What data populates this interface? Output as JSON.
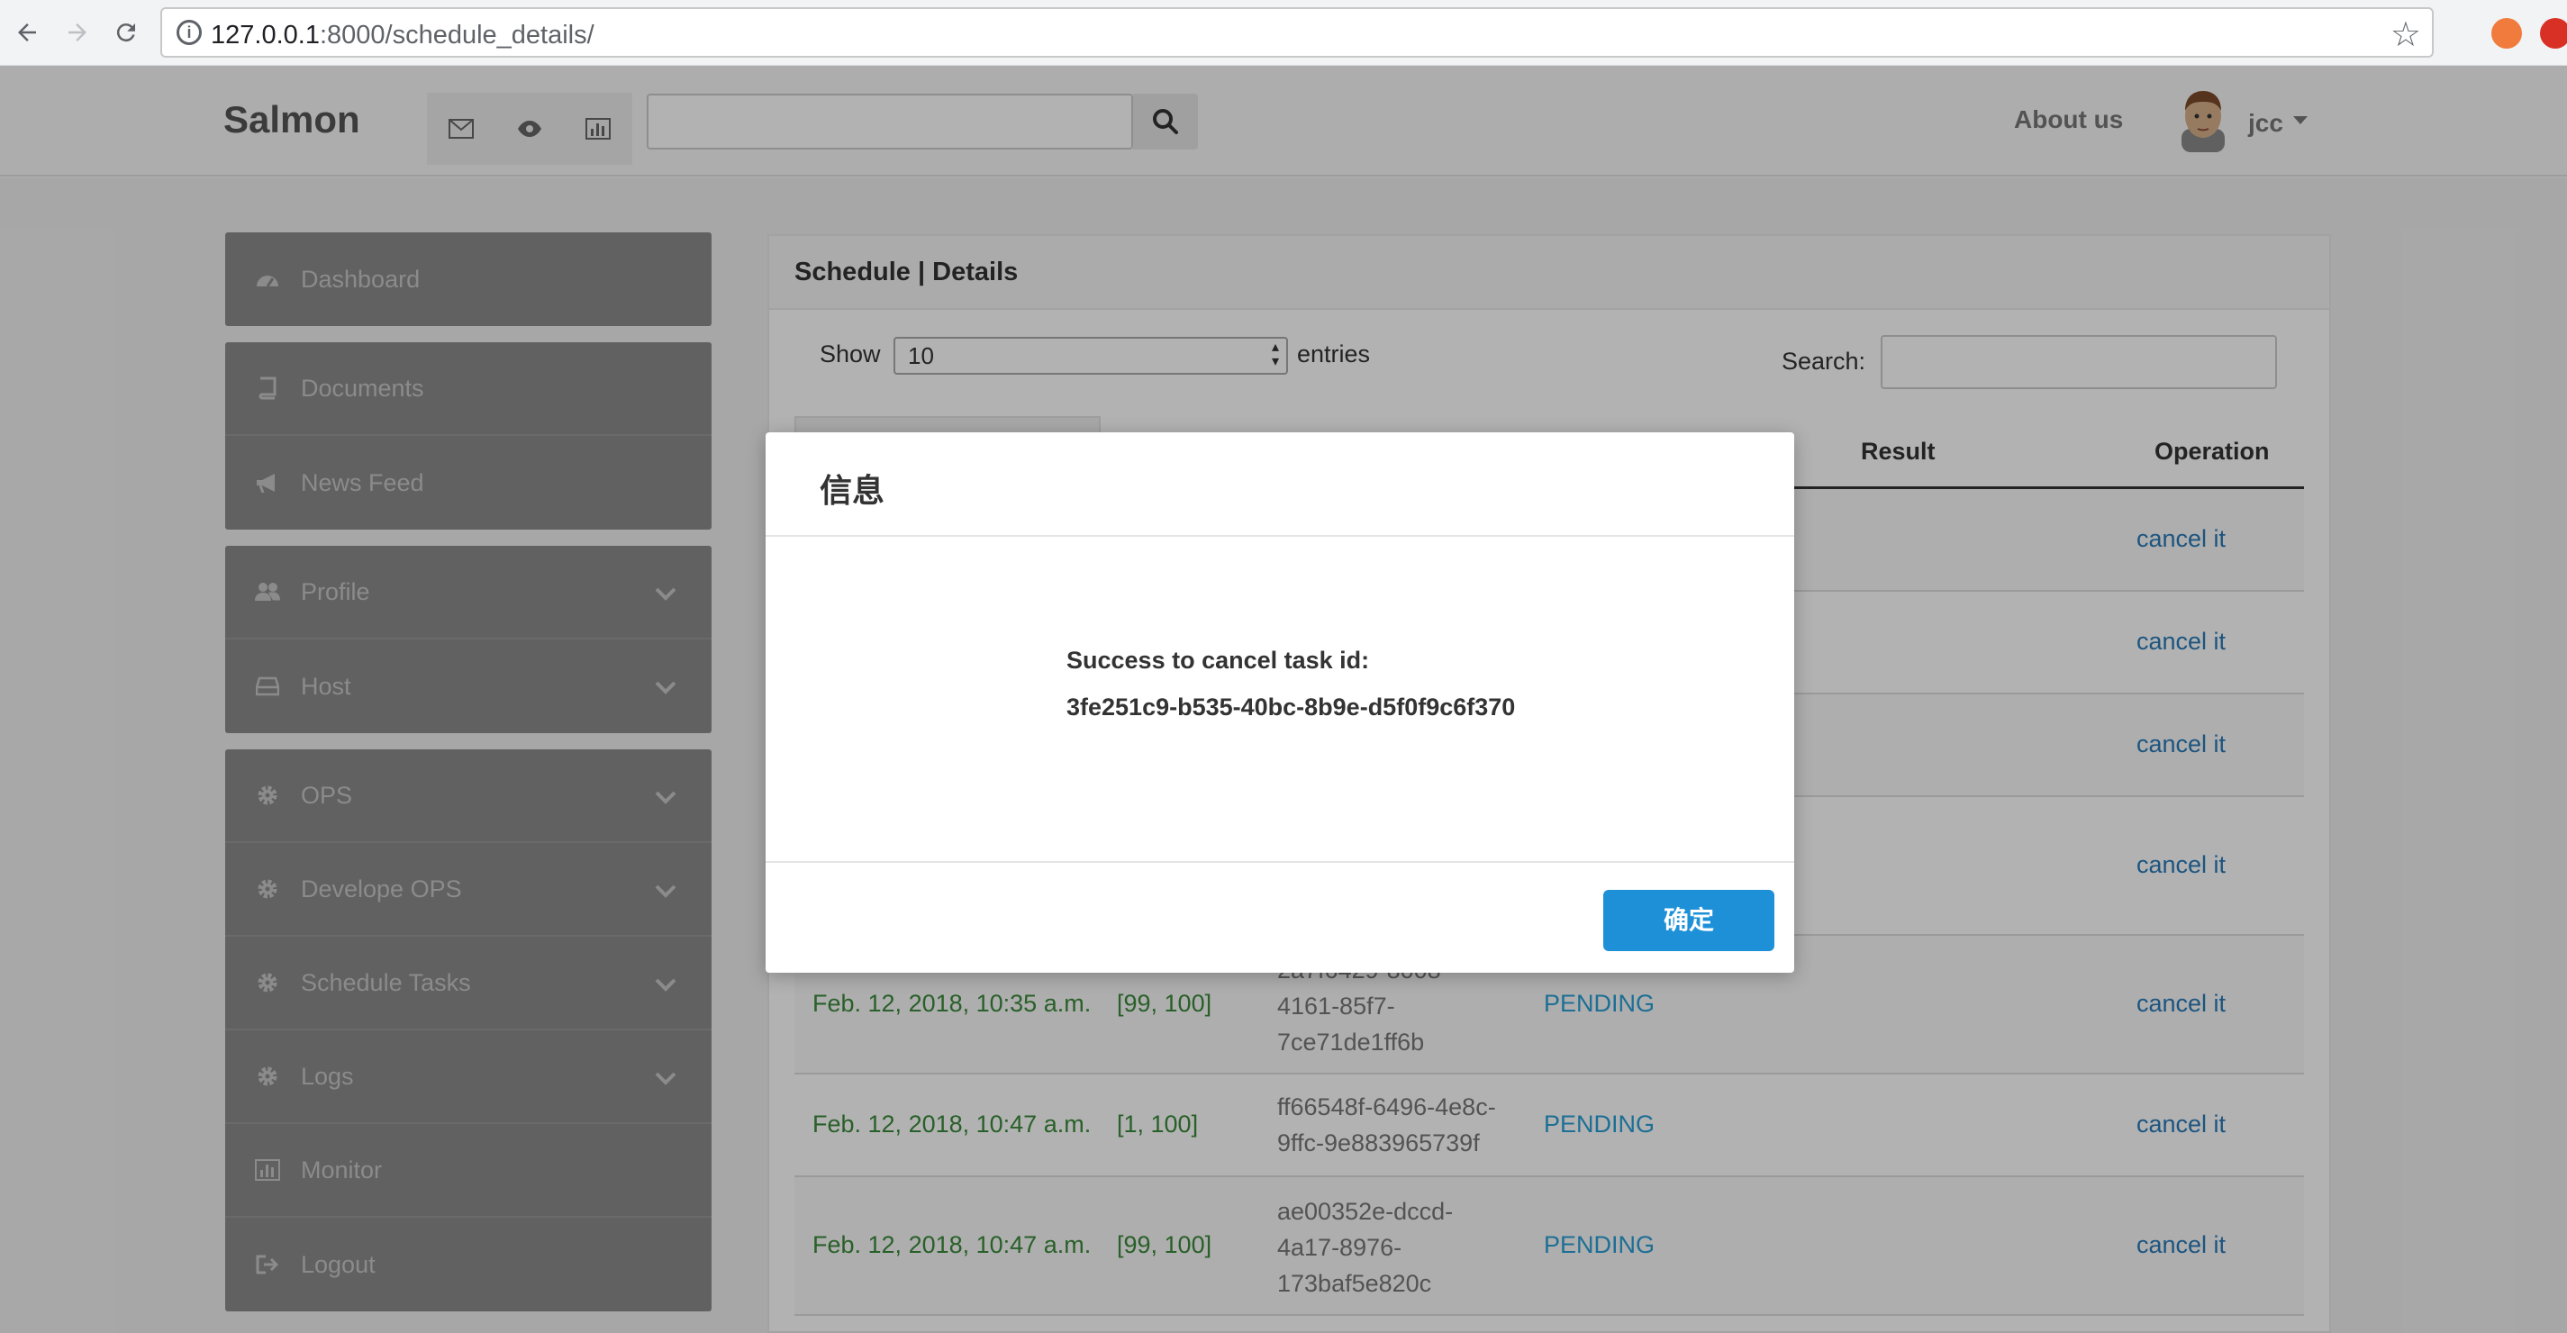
{
  "browser": {
    "url_host": "127.0.0.1",
    "url_rest": ":8000/schedule_details/"
  },
  "navbar": {
    "brand": "Salmon",
    "about": "About us",
    "user": "jcc"
  },
  "sidebar": {
    "groups": [
      [
        {
          "label": "Dashboard",
          "icon": "dashboard-icon"
        }
      ],
      [
        {
          "label": "Documents",
          "icon": "book-icon"
        },
        {
          "label": "News Feed",
          "icon": "megaphone-icon"
        }
      ],
      [
        {
          "label": "Profile",
          "icon": "users-icon",
          "expandable": true
        },
        {
          "label": "Host",
          "icon": "hdd-icon",
          "expandable": true
        }
      ],
      [
        {
          "label": "OPS",
          "icon": "gear-icon",
          "expandable": true
        },
        {
          "label": "Develope OPS",
          "icon": "gear-icon",
          "expandable": true
        },
        {
          "label": "Schedule Tasks",
          "icon": "gear-icon",
          "expandable": true
        },
        {
          "label": "Logs",
          "icon": "gear-icon",
          "expandable": true
        },
        {
          "label": "Monitor",
          "icon": "bar-chart-icon"
        },
        {
          "label": "Logout",
          "icon": "sign-out-icon"
        }
      ]
    ]
  },
  "panel": {
    "title": "Schedule | Details",
    "show_label": "Show",
    "show_value": "10",
    "entries_label": "entries",
    "search_label": "Search:",
    "headers": {
      "result": "Result",
      "operation": "Operation"
    },
    "rows": [
      {
        "time": "",
        "range": "",
        "id_lines": [],
        "status": "",
        "op": "cancel it"
      },
      {
        "time": "",
        "range": "",
        "id_lines": [],
        "status": "",
        "op": "cancel it"
      },
      {
        "time": "",
        "range": "",
        "id_lines": [],
        "status": "",
        "op": "cancel it"
      },
      {
        "time": "",
        "range": "",
        "id_lines": [],
        "status": "",
        "op": "cancel it"
      },
      {
        "time": "Feb. 12, 2018, 10:35 a.m.",
        "range": "[99, 100]",
        "id_lines": [
          "2a7f6429-8008-",
          "4161-85f7-",
          "7ce71de1ff6b"
        ],
        "status": "PENDING",
        "op": "cancel it"
      },
      {
        "time": "Feb. 12, 2018, 10:47 a.m.",
        "range": "[1, 100]",
        "id_lines": [
          "ff66548f-6496-4e8c-",
          "9ffc-9e883965739f"
        ],
        "status": "PENDING",
        "op": "cancel it"
      },
      {
        "time": "Feb. 12, 2018, 10:47 a.m.",
        "range": "[99, 100]",
        "id_lines": [
          "ae00352e-dccd-",
          "4a17-8976-",
          "173baf5e820c"
        ],
        "status": "PENDING",
        "op": "cancel it"
      }
    ]
  },
  "modal": {
    "title": "信息",
    "message_line1": "Success to cancel task id:",
    "message_line2": "3fe251c9-b535-40bc-8b9e-d5f0f9c6f370",
    "ok_label": "确定"
  }
}
